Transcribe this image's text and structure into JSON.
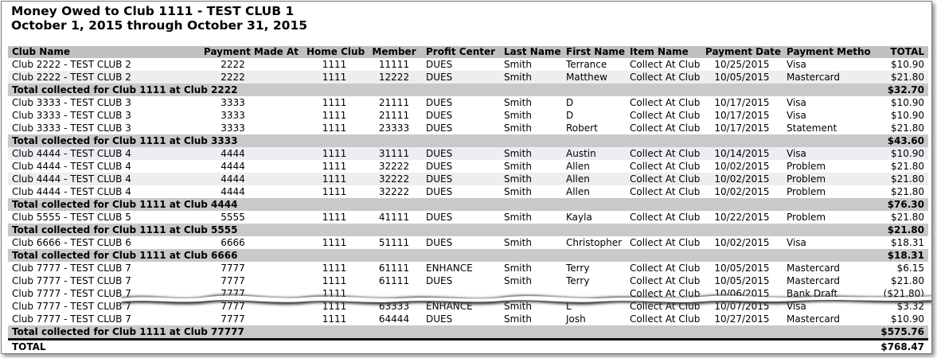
{
  "report": {
    "title": "Money Owed to Club 1111 - TEST CLUB 1",
    "subtitle": "October 1, 2015 through October 31, 2015"
  },
  "columns": [
    "Club Name",
    "Payment Made At",
    "Home Club",
    "Member",
    "Profit Center",
    "Last Name",
    "First Name",
    "Item Name",
    "Payment Date",
    "Payment Method",
    "TOTAL"
  ],
  "rows": [
    {
      "kind": "data",
      "cells": [
        "Club 2222 - TEST CLUB 2",
        "2222",
        "1111",
        "11111",
        "DUES",
        "Smith",
        "Terrance",
        "Collect At Club",
        "10/25/2015",
        "Visa",
        "$10.90"
      ]
    },
    {
      "kind": "data",
      "cells": [
        "Club 2222 - TEST CLUB 2",
        "2222",
        "1111",
        "12222",
        "DUES",
        "Smith",
        "Matthew",
        "Collect At Club",
        "10/05/2015",
        "Mastercard",
        "$21.80"
      ]
    },
    {
      "kind": "total",
      "label": "Total collected for Club 1111 at Club 2222",
      "amount": "$32.70"
    },
    {
      "kind": "data",
      "cells": [
        "Club 3333 - TEST CLUB 3",
        "3333",
        "1111",
        "21111",
        "DUES",
        "Smith",
        "D",
        "Collect At Club",
        "10/17/2015",
        "Visa",
        "$10.90"
      ]
    },
    {
      "kind": "data",
      "cells": [
        "Club 3333 - TEST CLUB 3",
        "3333",
        "1111",
        "21111",
        "DUES",
        "Smith",
        "D",
        "Collect At Club",
        "10/17/2015",
        "Visa",
        "$10.90"
      ]
    },
    {
      "kind": "data",
      "cells": [
        "Club 3333 - TEST CLUB 3",
        "3333",
        "1111",
        "23333",
        "DUES",
        "Smith",
        "Robert",
        "Collect At Club",
        "10/17/2015",
        "Statement",
        "$21.80"
      ]
    },
    {
      "kind": "total",
      "label": "Total collected for Club 1111 at Club 3333",
      "amount": "$43.60"
    },
    {
      "kind": "data",
      "cells": [
        "Club 4444 - TEST CLUB 4",
        "4444",
        "1111",
        "31111",
        "DUES",
        "Smith",
        "Austin",
        "Collect At Club",
        "10/14/2015",
        "Visa",
        "$10.90"
      ]
    },
    {
      "kind": "data",
      "cells": [
        "Club 4444 - TEST CLUB 4",
        "4444",
        "1111",
        "32222",
        "DUES",
        "Smith",
        "Allen",
        "Collect At Club",
        "10/02/2015",
        "Problem",
        "$21.80"
      ]
    },
    {
      "kind": "data",
      "cells": [
        "Club 4444 - TEST CLUB 4",
        "4444",
        "1111",
        "32222",
        "DUES",
        "Smith",
        "Allen",
        "Collect At Club",
        "10/02/2015",
        "Problem",
        "$21.80"
      ]
    },
    {
      "kind": "data",
      "cells": [
        "Club 4444 - TEST CLUB 4",
        "4444",
        "1111",
        "32222",
        "DUES",
        "Smith",
        "Allen",
        "Collect At Club",
        "10/02/2015",
        "Problem",
        "$21.80"
      ]
    },
    {
      "kind": "total",
      "label": "Total collected for Club 1111 at Club 4444",
      "amount": "$76.30"
    },
    {
      "kind": "data",
      "cells": [
        "Club 5555 - TEST CLUB 5",
        "5555",
        "1111",
        "41111",
        "DUES",
        "Smith",
        "Kayla",
        "Collect At Club",
        "10/22/2015",
        "Problem",
        "$21.80"
      ]
    },
    {
      "kind": "total",
      "label": "Total collected for Club 1111 at Club 5555",
      "amount": "$21.80"
    },
    {
      "kind": "data",
      "cells": [
        "Club 6666 - TEST CLUB 6",
        "6666",
        "1111",
        "51111",
        "DUES",
        "Smith",
        "Christopher",
        "Collect At Club",
        "10/02/2015",
        "Visa",
        "$18.31"
      ]
    },
    {
      "kind": "total",
      "label": "Total collected for Club 1111 at Club 6666",
      "amount": "$18.31"
    },
    {
      "kind": "data",
      "cells": [
        "Club 7777 - TEST CLUB 7",
        "7777",
        "1111",
        "61111",
        "ENHANCE",
        "Smith",
        "Terry",
        "Collect At Club",
        "10/05/2015",
        "Mastercard",
        "$6.15"
      ]
    },
    {
      "kind": "data",
      "cells": [
        "Club 7777 - TEST CLUB 7",
        "7777",
        "1111",
        "61111",
        "DUES",
        "Smith",
        "Terry",
        "Collect At Club",
        "10/05/2015",
        "Mastercard",
        "$21.80"
      ]
    },
    {
      "kind": "data",
      "cells": [
        "Club 7777 - TEST CLUB 7",
        "7777",
        "1111",
        "",
        "",
        "",
        "",
        "Collect At Club",
        "10/06/2015",
        "Bank Draft",
        "($21.80)"
      ]
    },
    {
      "kind": "data",
      "cells": [
        "Club 7777 - TEST CLUB 7",
        "7777",
        "1111",
        "63333",
        "ENHANCE",
        "Smith",
        "L",
        "Collect At Club",
        "10/07/2015",
        "Visa",
        "$3.32"
      ]
    },
    {
      "kind": "data",
      "cells": [
        "Club 7777 - TEST CLUB 7",
        "7777",
        "1111",
        "64444",
        "DUES",
        "Smith",
        "Josh",
        "Collect At Club",
        "10/27/2015",
        "Mastercard",
        "$10.90"
      ]
    },
    {
      "kind": "total",
      "label": "Total collected for Club 1111 at Club 77777",
      "amount": "$575.76"
    }
  ],
  "grand_total": {
    "label": "TOTAL",
    "amount": "$768.47"
  }
}
